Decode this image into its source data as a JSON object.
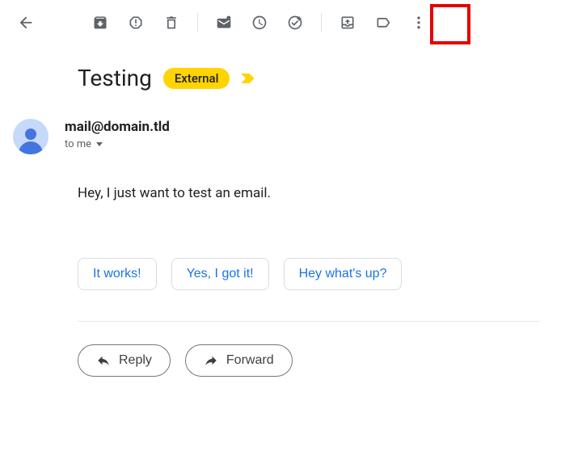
{
  "subject": "Testing",
  "badge": "External",
  "sender": "mail@domain.tld",
  "to_label": "to me",
  "body": "Hey, I just want to test an email.",
  "smart_replies": [
    "It works!",
    "Yes, I got it!",
    "Hey what's up?"
  ],
  "actions": {
    "reply": "Reply",
    "forward": "Forward"
  },
  "toolbar": {
    "back": "back",
    "archive": "archive",
    "spam": "report-spam",
    "delete": "delete",
    "unread": "mark-unread",
    "snooze": "snooze",
    "task": "add-to-tasks",
    "move": "move-to-inbox",
    "label": "labels",
    "more": "more"
  }
}
